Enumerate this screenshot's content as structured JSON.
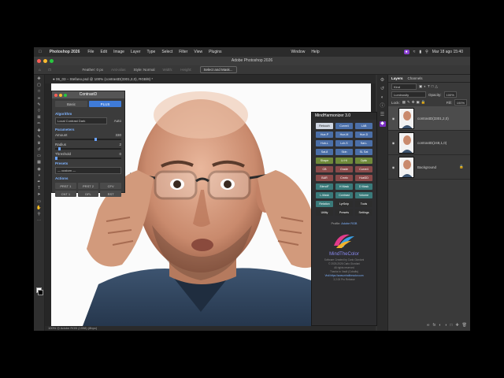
{
  "macmenu": {
    "app": "Photoshop 2026",
    "items": [
      "File",
      "Edit",
      "Image",
      "Layer",
      "Type",
      "Select",
      "Filter",
      "View",
      "Plugins"
    ],
    "right": [
      "Window",
      "Help"
    ],
    "clock": "Mar 18 ago  15:40"
  },
  "window": {
    "title": "Adobe Photoshop 2026"
  },
  "options": {
    "feather": "Feather:  0 px",
    "antialias": "Anti-alias",
    "style": "Style:  Normal",
    "width": "Width:",
    "height": "Height:",
    "button": "Select and Mask..."
  },
  "document": {
    "tab": "● 06_03 – Stefano.psd @ 100% (contrastD(3301,2,0), RGB/8) *",
    "status": "100%    ◎  Adobe RGB (1998) (8bpc)"
  },
  "contrastd": {
    "title": "ContrastD",
    "tabs": [
      "Basic",
      "PLUS"
    ],
    "algorithm_label": "Algorithm",
    "algorithm_value": "Local Contrast Dark",
    "auto": "Auto",
    "params_label": "Parameters",
    "amount": "Amount",
    "amount_val": "330",
    "radius": "Radius",
    "radius_val": "2",
    "threshold": "Threshold",
    "threshold_val": "0",
    "presets_label": "Presets",
    "preset_value": "— custom —",
    "actions_label": "Actions",
    "actions": [
      "PRST 1",
      "PRST 2",
      "CFV",
      "CNT 1",
      "DFL",
      "RST"
    ]
  },
  "mindharmonizer": {
    "title": "MindHarmonizer 3.0",
    "buttons": [
      {
        "l": "Retouch",
        "c": "#cfd6e2",
        "t": "#222"
      },
      {
        "l": "Curve4",
        "c": "#4b6fa8",
        "t": "#fff"
      },
      {
        "l": "LAB",
        "c": "#4b6fa8",
        "t": "#fff"
      },
      {
        "l": "Hue-P",
        "c": "#4b6fa8",
        "t": "#fff"
      },
      {
        "l": "Hue-M",
        "c": "#4b6fa8",
        "t": "#fff"
      },
      {
        "l": "Hue-D",
        "c": "#4b6fa8",
        "t": "#fff"
      },
      {
        "l": "Hub-L",
        "c": "#4b6fa8",
        "t": "#fff"
      },
      {
        "l": "Lch-S",
        "c": "#4b6fa8",
        "t": "#fff"
      },
      {
        "l": "Sat-L",
        "c": "#4b6fa8",
        "t": "#fff"
      },
      {
        "l": "Sat-8",
        "c": "#4b6fa8",
        "t": "#fff"
      },
      {
        "l": "Skin",
        "c": "#4b6fa8",
        "t": "#fff"
      },
      {
        "l": "SL Sat",
        "c": "#4b6fa8",
        "t": "#fff"
      },
      {
        "l": "Shape",
        "c": "#6f8a3a",
        "t": "#fff"
      },
      {
        "l": "Lt Hi",
        "c": "#6f8a3a",
        "t": "#fff"
      },
      {
        "l": "Optic",
        "c": "#6f8a3a",
        "t": "#fff"
      },
      {
        "l": "CB",
        "c": "#8a4a4a",
        "t": "#fff"
      },
      {
        "l": "Grade",
        "c": "#8a4a4a",
        "t": "#fff"
      },
      {
        "l": "Curve4",
        "c": "#8a4a4a",
        "t": "#fff"
      },
      {
        "l": "BAR",
        "c": "#8a4a4a",
        "t": "#fff"
      },
      {
        "l": "Crnrtx",
        "c": "#8a4a4a",
        "t": "#fff"
      },
      {
        "l": "HueDD",
        "c": "#8a4a4a",
        "t": "#fff"
      },
      {
        "l": "BlendF",
        "c": "#3a7a7a",
        "t": "#fff"
      },
      {
        "l": "H Mask",
        "c": "#3a7a7a",
        "t": "#fff"
      },
      {
        "l": "D Mask",
        "c": "#3a7a7a",
        "t": "#fff"
      },
      {
        "l": "L.Mask",
        "c": "#3a7a7a",
        "t": "#fff"
      },
      {
        "l": "Contrast",
        "c": "#3a7a7a",
        "t": "#fff"
      },
      {
        "l": "Volume",
        "c": "#3a7a7a",
        "t": "#fff"
      },
      {
        "l": "Relation",
        "c": "#3a7a7a",
        "t": "#fff"
      },
      {
        "l": "LyrSnip",
        "c": "#2d2d2d",
        "t": "#fff"
      },
      {
        "l": "Tools",
        "c": "#2d2d2d",
        "t": "#fff"
      },
      {
        "l": "Utility",
        "c": "#2d2d2d",
        "t": "#fff"
      },
      {
        "l": "Presets",
        "c": "#2d2d2d",
        "t": "#fff"
      },
      {
        "l": "Settings",
        "c": "#2d2d2d",
        "t": "#fff"
      }
    ],
    "profile_label": "Profile:",
    "profile_value": "Adobe RGB",
    "brand": "MindTheColor",
    "credits": [
      "Software Created by Carlo Giordani",
      "© 2025-2026 Carlo Giordani",
      "All rights reserved",
      "Thanks to Vasili (Cobalts)",
      "Visit https://www.mindthecolor.com",
      "3.2.00 Pro Release"
    ]
  },
  "layers": {
    "tabs": [
      "Layers",
      "Channels"
    ],
    "kind": "Kind",
    "blend": "Luminosity",
    "opacity_label": "Opacity:",
    "opacity": "100%",
    "lock_label": "Lock:",
    "fill_label": "Fill:",
    "fill": "100%",
    "items": [
      {
        "name": "contrastD(3301,2,0)",
        "selected": true
      },
      {
        "name": "contrastD(248,1,0)",
        "selected": false
      },
      {
        "name": "Background",
        "selected": false
      }
    ]
  }
}
